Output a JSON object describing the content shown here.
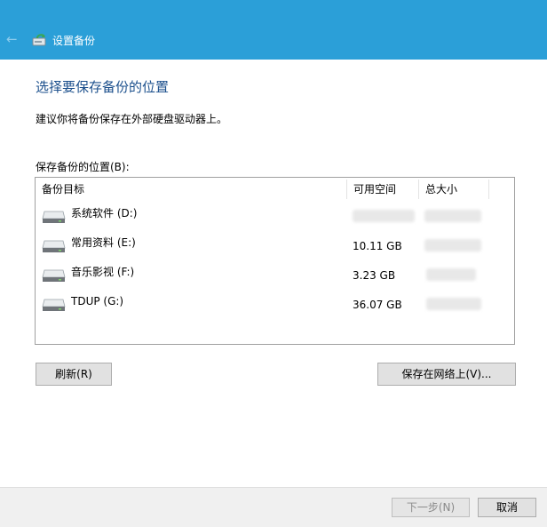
{
  "window": {
    "title": "设置备份"
  },
  "main": {
    "heading": "选择要保存备份的位置",
    "subtext": "建议你将备份保存在外部硬盘驱动器上。",
    "list_label": "保存备份的位置(B):"
  },
  "list": {
    "columns": [
      "备份目标",
      "可用空间",
      "总大小"
    ],
    "rows": [
      {
        "name": "系统软件 (D:)",
        "free": "",
        "total": ""
      },
      {
        "name": "常用资料 (E:)",
        "free": "10.11 GB",
        "total": ""
      },
      {
        "name": "音乐影视 (F:)",
        "free": "3.23 GB",
        "total": ""
      },
      {
        "name": "TDUP (G:)",
        "free": "36.07 GB",
        "total": ""
      }
    ]
  },
  "buttons": {
    "refresh": "刷新(R)",
    "save_network": "保存在网络上(V)...",
    "next": "下一步(N)",
    "cancel": "取消"
  },
  "colors": {
    "titlebar": "#2b9fd8",
    "heading": "#1b4f8c"
  }
}
